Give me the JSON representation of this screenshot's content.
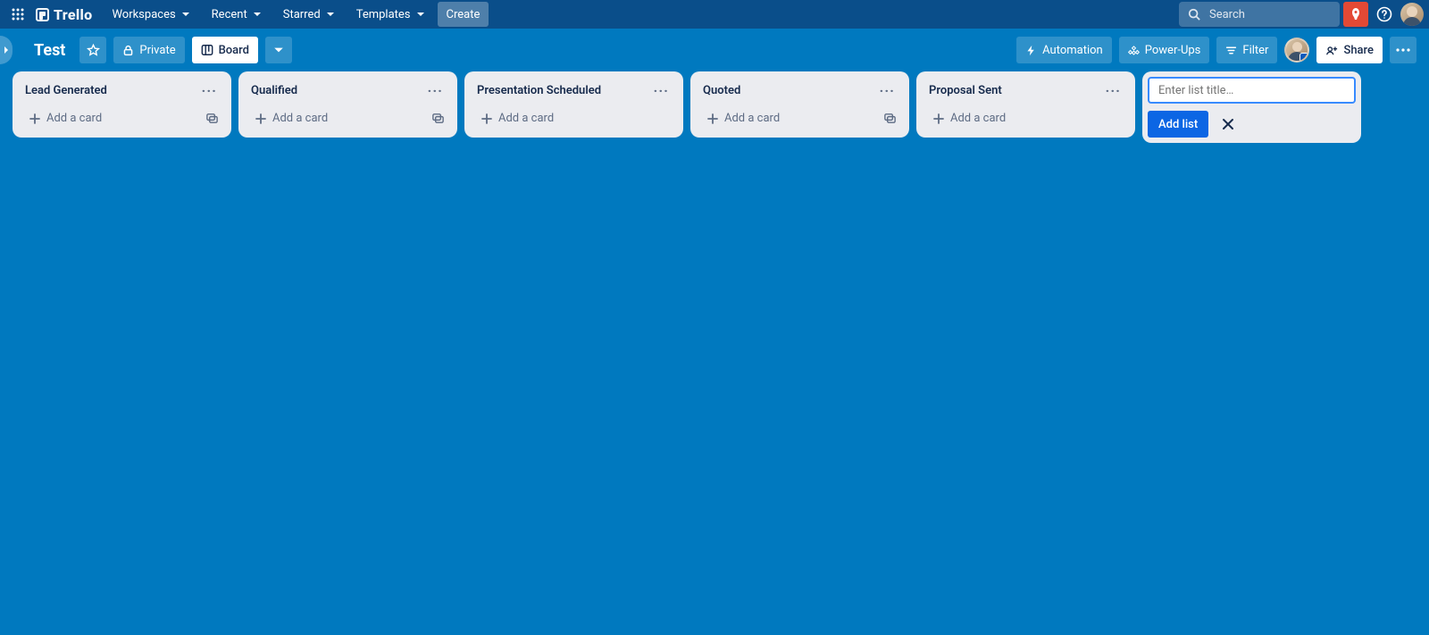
{
  "brand": "Trello",
  "nav": {
    "items": [
      {
        "label": "Workspaces"
      },
      {
        "label": "Recent"
      },
      {
        "label": "Starred"
      },
      {
        "label": "Templates"
      }
    ],
    "create_label": "Create",
    "search_placeholder": "Search"
  },
  "board": {
    "title": "Test",
    "privacy_label": "Private",
    "view_label": "Board",
    "automation_label": "Automation",
    "powerups_label": "Power-Ups",
    "filter_label": "Filter",
    "share_label": "Share"
  },
  "lists": [
    {
      "title": "Lead Generated"
    },
    {
      "title": "Qualified"
    },
    {
      "title": "Presentation Scheduled"
    },
    {
      "title": "Quoted"
    },
    {
      "title": "Proposal Sent"
    }
  ],
  "list_actions": {
    "add_card_label": "Add a card"
  },
  "composer": {
    "placeholder": "Enter list title…",
    "submit_label": "Add list"
  }
}
